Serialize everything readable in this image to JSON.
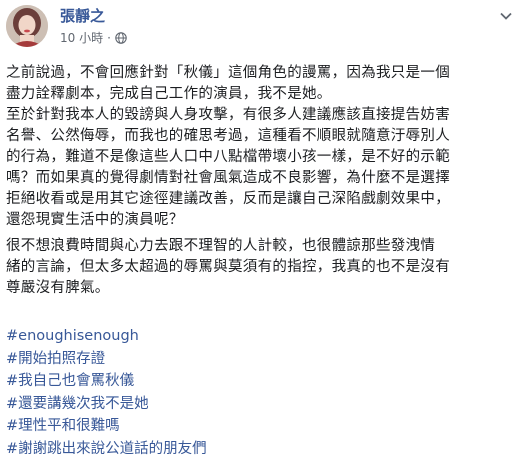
{
  "post": {
    "author": "張靜之",
    "time": "10 小時",
    "separator": "·",
    "paragraphs": [
      "之前說過，不會回應針對「秋儀」這個角色的謾罵，因為我只是一個\n盡力詮釋劇本，完成自己工作的演員，我不是她。",
      "至於針對我本人的毀謗與人身攻擊，有很多人建議應該直接提告妨害\n名譽、公然侮辱，而我也的確思考過，這種看不順眼就隨意汙辱別人\n的行為，難道不是像這些人口中八點檔帶壞小孩一樣，是不好的示範\n嗎？而如果真的覺得劇情對社會風氣造成不良影響，為什麼不是選擇\n拒絕收看或是用其它途徑建議改善，反而是讓自己深陷戲劇效果中，\n還怨現實生活中的演員呢？",
      "很不想浪費時間與心力去跟不理智的人計較，也很體諒那些發洩情\n緒的言論，但太多太超過的辱罵與莫須有的指控，我真的也不是沒有\n尊嚴沒有脾氣。"
    ],
    "hashtags": [
      "#enoughisenough",
      "#開始拍照存證",
      "#我自己也會罵秋儀",
      "#還要講幾次我不是她",
      "#理性平和很難嗎",
      "#謝謝跳出來說公道話的朋友們"
    ]
  },
  "colors": {
    "link": "#385898",
    "text": "#1c1e21",
    "meta": "#616770"
  },
  "icons": {
    "privacy": "globe-icon",
    "menu": "chevron-down-icon"
  }
}
